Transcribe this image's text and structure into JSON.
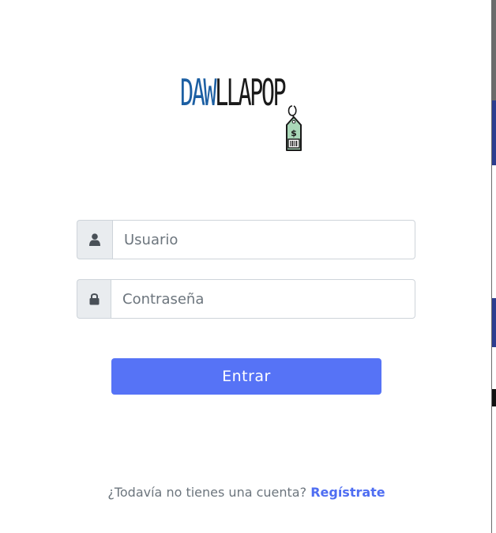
{
  "logo": {
    "part_blue": "DAW",
    "part_dark": "LLAPOP",
    "tag_symbol": "$"
  },
  "form": {
    "username_placeholder": "Usuario",
    "username_value": "",
    "password_placeholder": "Contraseña",
    "password_value": "",
    "submit_label": "Entrar"
  },
  "footer": {
    "prompt_text": "¿Todavía no tienes una cuenta?",
    "register_link": "Regístrate"
  },
  "colors": {
    "primary_button": "#5673f6",
    "link": "#4f6ef2",
    "logo_blue": "#1c5fa3",
    "tag_green": "#a9d8b8"
  },
  "icons": {
    "username": "user-icon",
    "password": "lock-icon",
    "logo_tag": "price-tag-icon"
  }
}
